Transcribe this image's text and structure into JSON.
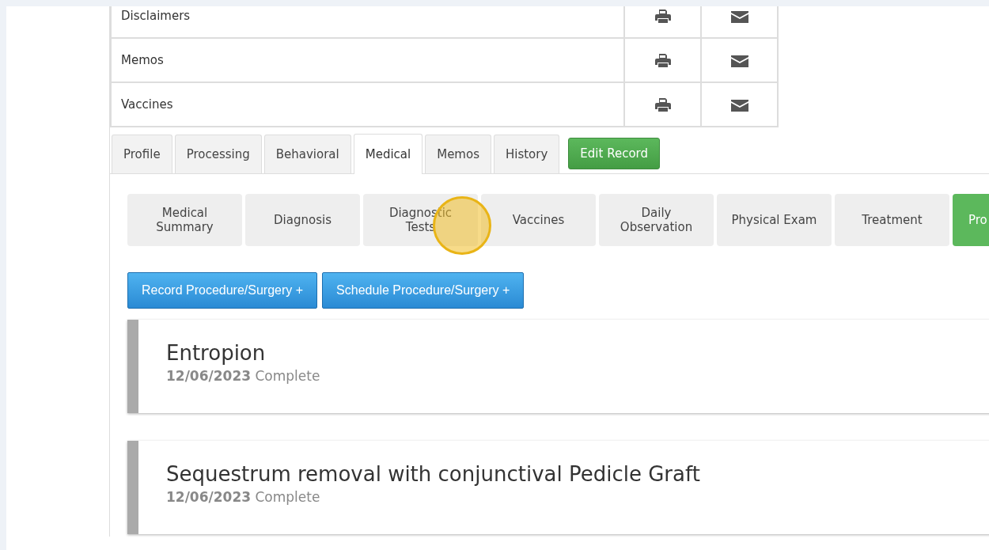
{
  "documents": [
    {
      "name": "Disclaimers"
    },
    {
      "name": "Memos"
    },
    {
      "name": "Vaccines"
    }
  ],
  "tabs": [
    {
      "label": "Profile",
      "selected": false
    },
    {
      "label": "Processing",
      "selected": false
    },
    {
      "label": "Behavioral",
      "selected": false
    },
    {
      "label": "Medical",
      "selected": true
    },
    {
      "label": "Memos",
      "selected": false
    },
    {
      "label": "History",
      "selected": false
    }
  ],
  "edit_button": "Edit Record",
  "subtabs": [
    {
      "label": "Medical Summary",
      "selected": false
    },
    {
      "label": "Diagnosis",
      "selected": false
    },
    {
      "label": "Diagnostic Tests",
      "selected": false
    },
    {
      "label": "Vaccines",
      "selected": false
    },
    {
      "label": "Daily Observation",
      "selected": false
    },
    {
      "label": "Physical Exam",
      "selected": false
    },
    {
      "label": "Treatment",
      "selected": false
    },
    {
      "label": "Pro",
      "selected": true
    }
  ],
  "actions": [
    "Record Procedure/Surgery +",
    "Schedule Procedure/Surgery +"
  ],
  "procedures": [
    {
      "title": "Entropion",
      "date": "12/06/2023",
      "status": "Complete"
    },
    {
      "title": "Sequestrum removal with conjunctival Pedicle Graft",
      "date": "12/06/2023",
      "status": "Complete"
    }
  ]
}
